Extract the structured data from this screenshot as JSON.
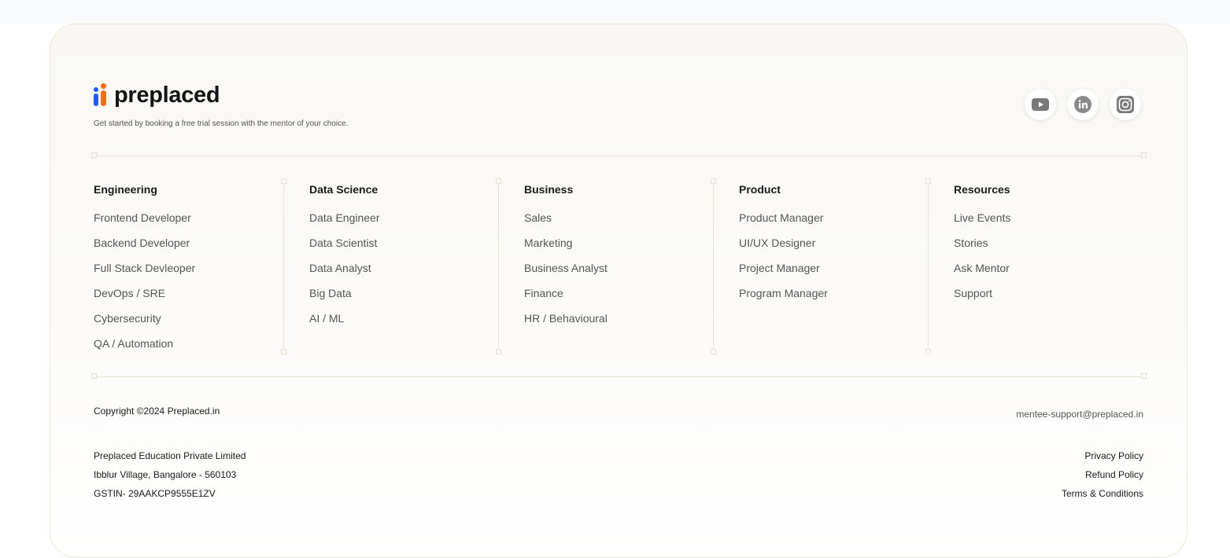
{
  "brand": {
    "name": "preplaced",
    "tagline": "Get started by booking a free trial session with the mentor of your choice.",
    "colors": {
      "blue": "#1f5cff",
      "orange": "#ff6a13"
    }
  },
  "socials": [
    {
      "icon": "youtube-icon"
    },
    {
      "icon": "linkedin-icon"
    },
    {
      "icon": "instagram-icon"
    }
  ],
  "columns": [
    {
      "title": "Engineering",
      "items": [
        "Frontend Developer",
        "Backend Developer",
        "Full Stack Devleoper",
        "DevOps / SRE",
        "Cybersecurity",
        "QA / Automation"
      ]
    },
    {
      "title": "Data Science",
      "items": [
        "Data Engineer",
        "Data Scientist",
        "Data Analyst",
        "Big Data",
        "AI / ML"
      ]
    },
    {
      "title": "Business",
      "items": [
        "Sales",
        "Marketing",
        "Business Analyst",
        "Finance",
        "HR / Behavioural"
      ]
    },
    {
      "title": "Product",
      "items": [
        "Product Manager",
        "UI/UX Designer",
        "Project Manager",
        "Program Manager"
      ]
    },
    {
      "title": "Resources",
      "items": [
        "Live Events",
        "Stories",
        "Ask Mentor",
        "Support"
      ]
    }
  ],
  "bottom": {
    "copyright": "Copyright ©2024 Preplaced.in",
    "email": "mentee-support@preplaced.in",
    "company_lines": [
      "Preplaced Education Private Limited",
      "Ibblur Village, Bangalore - 560103",
      "GSTIN- 29AAKCP9555E1ZV"
    ],
    "legal_links": [
      "Privacy Policy",
      "Refund Policy",
      "Terms & Conditions"
    ]
  }
}
